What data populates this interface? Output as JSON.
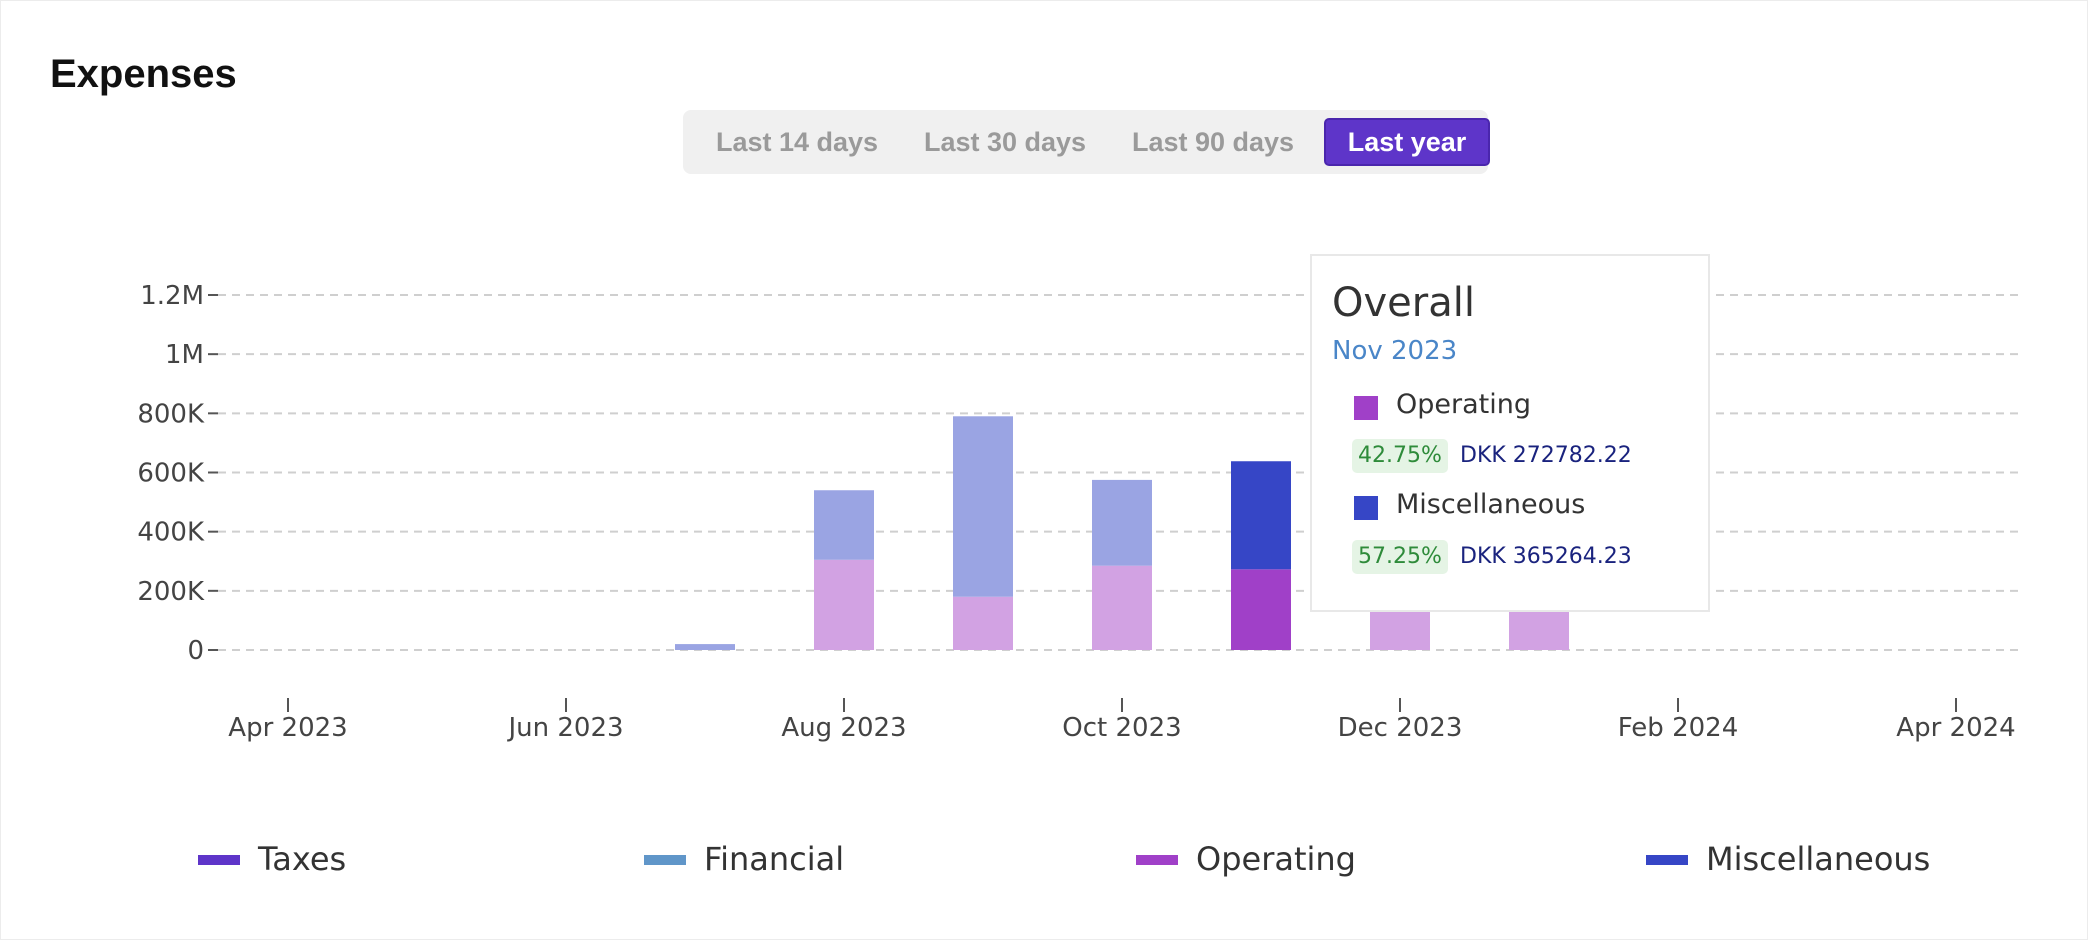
{
  "header": {
    "title": "Expenses"
  },
  "range_buttons": [
    {
      "label": "Last 14 days",
      "active": false
    },
    {
      "label": "Last 30 days",
      "active": false
    },
    {
      "label": "Last 90 days",
      "active": false
    },
    {
      "label": "Last year",
      "active": true
    }
  ],
  "colors": {
    "Taxes": "#5e35c9",
    "Financial": "#6096c9",
    "Operating": "#a040c8",
    "Miscellaneous": "#3646c6",
    "operating_faded": "#d2a2e3",
    "misc_faded": "#9aa4e3",
    "accent": "#5e35c9"
  },
  "tooltip": {
    "title": "Overall",
    "date": "Nov 2023",
    "rows": [
      {
        "name": "Operating",
        "pct": "42.75%",
        "amount": "DKK 272782.22"
      },
      {
        "name": "Miscellaneous",
        "pct": "57.25%",
        "amount": "DKK 365264.23"
      }
    ]
  },
  "legend": [
    "Taxes",
    "Financial",
    "Operating",
    "Miscellaneous"
  ],
  "chart_data": {
    "type": "bar",
    "stacked": true,
    "x_tick_labels": [
      "Apr 2023",
      "Jun 2023",
      "Aug 2023",
      "Oct 2023",
      "Dec 2023",
      "Feb 2024",
      "Apr 2024"
    ],
    "y_tick_labels": [
      "0",
      "200K",
      "400K",
      "600K",
      "800K",
      "1M",
      "1.2M"
    ],
    "ylim": [
      0,
      1200000
    ],
    "grid": true,
    "legend_position": "bottom",
    "categories": [
      "Jul 2023",
      "Aug 2023",
      "Sep 2023",
      "Oct 2023",
      "Nov 2023",
      "Dec 2023",
      "Jan 2024"
    ],
    "highlighted": "Nov 2023",
    "series": [
      {
        "name": "Operating",
        "values": [
          0,
          305000,
          180000,
          285000,
          272782.22,
          130000,
          130000
        ]
      },
      {
        "name": "Miscellaneous",
        "values": [
          20000,
          235000,
          610000,
          290000,
          365264.23,
          0,
          0
        ]
      }
    ]
  }
}
